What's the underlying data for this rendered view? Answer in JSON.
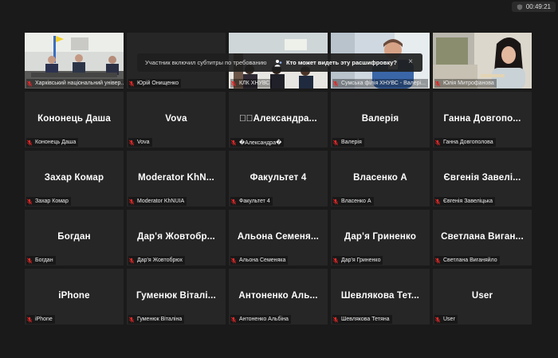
{
  "timer": "00:49:21",
  "caption_notice": {
    "message": "Участник включил субтитры по требованию",
    "question": "Кто может видеть эту расшифровку?",
    "close": "×"
  },
  "tiles": [
    {
      "name": "",
      "label": "Харківський національний універ...",
      "video": "room"
    },
    {
      "name": "",
      "label": "Юрій Онищенко",
      "video": "dark"
    },
    {
      "name": "",
      "label": "КЛК ХНУВС",
      "video": "class"
    },
    {
      "name": "",
      "label": "Сумська філія ХНУВС - Валері...",
      "video": "man"
    },
    {
      "name": "",
      "label": "Юлія Митрофанова",
      "video": "woman"
    },
    {
      "name": "Кононець Даша",
      "label": "Кононець Даша"
    },
    {
      "name": "Vova",
      "label": "Vova"
    },
    {
      "name": "✚⃞Александра...",
      "label": "�Александра�"
    },
    {
      "name": "Валерія",
      "label": "Валерія"
    },
    {
      "name": "Ганна Довгопо...",
      "label": "Ганна Довгополова"
    },
    {
      "name": "Захар Комар",
      "label": "Захар Комар"
    },
    {
      "name": "Moderator KhN...",
      "label": "Moderator KhNUIA"
    },
    {
      "name": "Факультет 4",
      "label": "Факультет 4"
    },
    {
      "name": "Власенко А",
      "label": "Власенко А"
    },
    {
      "name": "Євгенія Завелі...",
      "label": "Євгенія Завеліцька"
    },
    {
      "name": "Богдан",
      "label": "Богдан"
    },
    {
      "name": "Дар'я Жовтобр...",
      "label": "Дар'я Жовтобрюх"
    },
    {
      "name": "Альона Семеня...",
      "label": "Альона Семеняка"
    },
    {
      "name": "Дар'я Гриненко",
      "label": "Дар'я Гриненко"
    },
    {
      "name": "Светлана Виган...",
      "label": "Светлана Виганяйло"
    },
    {
      "name": "iPhone",
      "label": "iPhone"
    },
    {
      "name": "Гуменюк Віталі...",
      "label": "Гуменюк Віталіна"
    },
    {
      "name": "Антоненко Аль...",
      "label": "Антоненко Альбіна"
    },
    {
      "name": "Шевлякова Тет...",
      "label": "Шевлякова Тетяна"
    },
    {
      "name": "User",
      "label": "User"
    }
  ],
  "colors": {
    "active_border": "#c7dd54",
    "muted_icon": "#e02828",
    "tile_bg": "#262626"
  }
}
